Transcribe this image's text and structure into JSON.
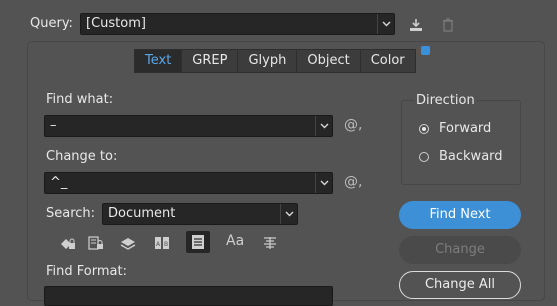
{
  "query": {
    "label": "Query:",
    "value": "[Custom]"
  },
  "tabs": [
    {
      "label": "Text",
      "active": true
    },
    {
      "label": "GREP"
    },
    {
      "label": "Glyph"
    },
    {
      "label": "Object"
    },
    {
      "label": "Color"
    }
  ],
  "find": {
    "label": "Find what:",
    "value": "–"
  },
  "change": {
    "label": "Change to:",
    "value": "^_"
  },
  "search": {
    "label": "Search:",
    "value": "Document"
  },
  "special_char_glyph": "@,",
  "direction": {
    "title": "Direction",
    "options": [
      {
        "label": "Forward",
        "selected": true
      },
      {
        "label": "Backward",
        "selected": false
      }
    ]
  },
  "buttons": {
    "find_next": "Find Next",
    "change": "Change",
    "change_all": "Change All"
  },
  "option_icons": [
    "include-locked-layers-icon",
    "include-locked-stories-icon",
    "include-hidden-layers-icon",
    "include-master-pages-icon",
    "include-footnotes-icon",
    "case-sensitive-icon",
    "whole-word-icon"
  ],
  "case_icon_text": "Aa",
  "find_format": {
    "label": "Find Format:"
  },
  "colors": {
    "accent": "#3d8fd6",
    "tab_active_text": "#5aa7e8",
    "background": "#535353",
    "field": "#262626"
  }
}
